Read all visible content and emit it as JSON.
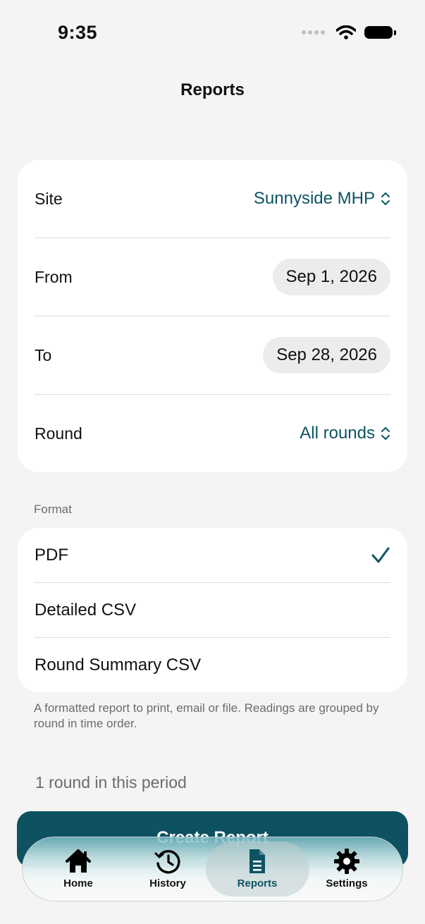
{
  "status_bar": {
    "time": "9:35"
  },
  "nav": {
    "title": "Reports"
  },
  "filters": {
    "site": {
      "label": "Site",
      "value": "Sunnyside MHP"
    },
    "from": {
      "label": "From",
      "value": "Sep 1, 2026"
    },
    "to": {
      "label": "To",
      "value": "Sep 28, 2026"
    },
    "round": {
      "label": "Round",
      "value": "All rounds"
    }
  },
  "format": {
    "section_label": "Format",
    "options": [
      {
        "label": "PDF",
        "selected": true
      },
      {
        "label": "Detailed CSV",
        "selected": false
      },
      {
        "label": "Round Summary CSV",
        "selected": false
      }
    ],
    "footnote": "A formatted report to print, email or file. Readings are grouped by round in time order."
  },
  "summary": {
    "count_text": "1 round in this period"
  },
  "actions": {
    "create_label": "Create Report"
  },
  "tabbar": {
    "tabs": [
      {
        "label": "Home",
        "icon": "house-icon"
      },
      {
        "label": "History",
        "icon": "clock-history-icon"
      },
      {
        "label": "Reports",
        "icon": "document-icon",
        "active": true
      },
      {
        "label": "Settings",
        "icon": "gear-icon"
      }
    ]
  },
  "colors": {
    "accent": "#0d5462",
    "button": "#0e5160",
    "background": "#f3f4f3"
  }
}
